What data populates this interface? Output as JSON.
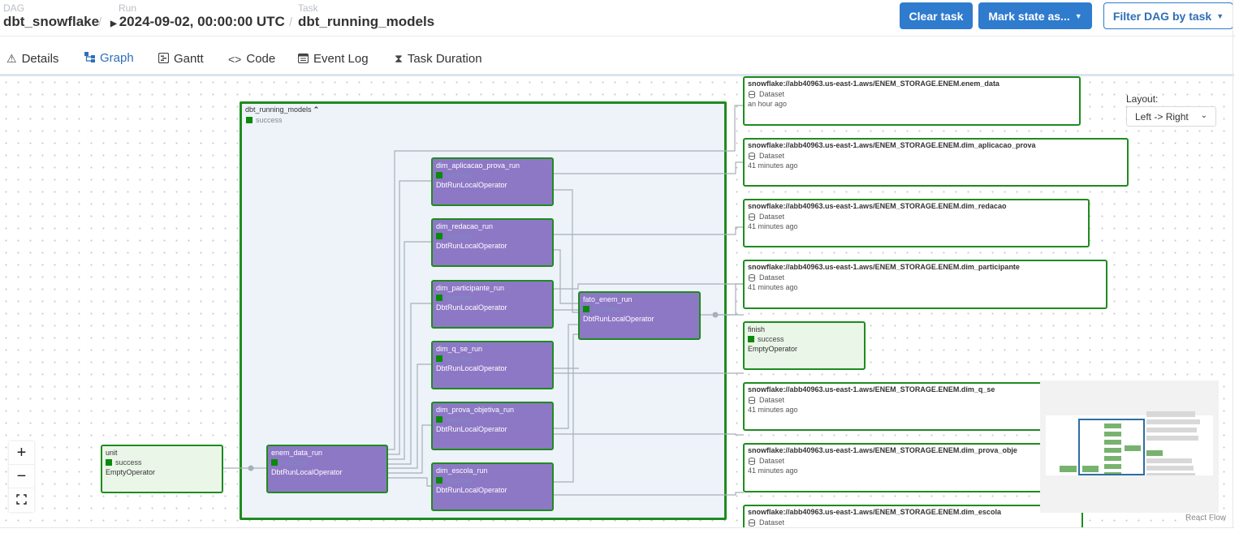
{
  "header": {
    "dag_label": "DAG",
    "dag_value": "dbt_snowflake",
    "run_label": "Run",
    "run_value": "2024-09-02, 00:00:00 UTC",
    "task_label": "Task",
    "task_value": "dbt_running_models",
    "separator": "/",
    "buttons": {
      "clear_task": "Clear task",
      "mark_state": "Mark state as...",
      "filter_dag": "Filter DAG by task"
    }
  },
  "tabs": [
    {
      "label": "Details",
      "icon": "warning-triangle-icon",
      "active": false
    },
    {
      "label": "Graph",
      "icon": "graph-icon",
      "active": true
    },
    {
      "label": "Gantt",
      "icon": "gantt-icon",
      "active": false
    },
    {
      "label": "Code",
      "icon": "code-icon",
      "active": false
    },
    {
      "label": "Event Log",
      "icon": "calendar-icon",
      "active": false
    },
    {
      "label": "Task Duration",
      "icon": "hourglass-icon",
      "active": false
    }
  ],
  "graph": {
    "group": {
      "title": "dbt_running_models",
      "status": "success",
      "expand_icon": "chevron-up-icon"
    },
    "status_color": "#0a8a0a",
    "operator_color": "#8d78c6",
    "border_color": "#1f8b1f",
    "nodes": {
      "unit": {
        "name": "unit",
        "status": "success",
        "operator": "EmptyOperator"
      },
      "enem_data_run": {
        "name": "enem_data_run",
        "status": "success",
        "operator": "DbtRunLocalOperator"
      },
      "dim_aplicacao_prova_run": {
        "name": "dim_aplicacao_prova_run",
        "status": "success",
        "operator": "DbtRunLocalOperator"
      },
      "dim_redacao_run": {
        "name": "dim_redacao_run",
        "status": "success",
        "operator": "DbtRunLocalOperator"
      },
      "dim_participante_run": {
        "name": "dim_participante_run",
        "status": "success",
        "operator": "DbtRunLocalOperator"
      },
      "dim_q_se_run": {
        "name": "dim_q_se_run",
        "status": "success",
        "operator": "DbtRunLocalOperator"
      },
      "dim_prova_objetiva_run": {
        "name": "dim_prova_objetiva_run",
        "status": "success",
        "operator": "DbtRunLocalOperator"
      },
      "dim_escola_run": {
        "name": "dim_escola_run",
        "status": "success",
        "operator": "DbtRunLocalOperator"
      },
      "fato_enem_run": {
        "name": "fato_enem_run",
        "status": "success",
        "operator": "DbtRunLocalOperator"
      },
      "finish": {
        "name": "finish",
        "status": "success",
        "operator": "EmptyOperator"
      }
    },
    "datasets": {
      "enem_data": {
        "uri": "snowflake://abb40963.us-east-1.aws/ENEM_STORAGE.ENEM.enem_data",
        "kind": "Dataset",
        "updated": "an hour ago"
      },
      "dim_aplicacao_prova": {
        "uri": "snowflake://abb40963.us-east-1.aws/ENEM_STORAGE.ENEM.dim_aplicacao_prova",
        "kind": "Dataset",
        "updated": "41 minutes ago"
      },
      "dim_redacao": {
        "uri": "snowflake://abb40963.us-east-1.aws/ENEM_STORAGE.ENEM.dim_redacao",
        "kind": "Dataset",
        "updated": "41 minutes ago"
      },
      "dim_participante": {
        "uri": "snowflake://abb40963.us-east-1.aws/ENEM_STORAGE.ENEM.dim_participante",
        "kind": "Dataset",
        "updated": "41 minutes ago"
      },
      "dim_q_se": {
        "uri": "snowflake://abb40963.us-east-1.aws/ENEM_STORAGE.ENEM.dim_q_se",
        "kind": "Dataset",
        "updated": "41 minutes ago"
      },
      "dim_prova_objetiva": {
        "uri": "snowflake://abb40963.us-east-1.aws/ENEM_STORAGE.ENEM.dim_prova_obje",
        "kind": "Dataset",
        "updated": "41 minutes ago"
      },
      "dim_escola": {
        "uri": "snowflake://abb40963.us-east-1.aws/ENEM_STORAGE.ENEM.dim_escola",
        "kind": "Dataset",
        "updated": ""
      }
    }
  },
  "layout_control": {
    "label": "Layout:",
    "value": "Left -> Right"
  },
  "zoom_controls": {
    "zoom_in": "+",
    "zoom_out": "−"
  },
  "attribution": "React Flow"
}
